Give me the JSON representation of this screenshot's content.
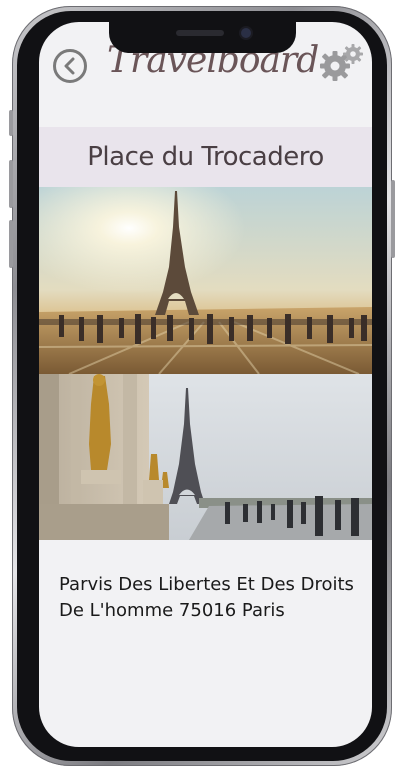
{
  "header": {
    "title": "Travelboard",
    "back_icon": "chevron-left-circle-icon",
    "settings_icon": "gears-icon"
  },
  "place": {
    "name": "Place du Trocadero",
    "address": "Parvis Des Libertes Et Des Droits De L'homme 75016 Paris"
  },
  "photos": [
    {
      "subject": "eiffel-tower-sunset-photo"
    },
    {
      "subject": "eiffel-tower-statues-photo"
    }
  ],
  "colors": {
    "title_color": "#6a5558",
    "place_bar_bg": "#e9e4ec",
    "screen_bg": "#f2f2f4"
  }
}
